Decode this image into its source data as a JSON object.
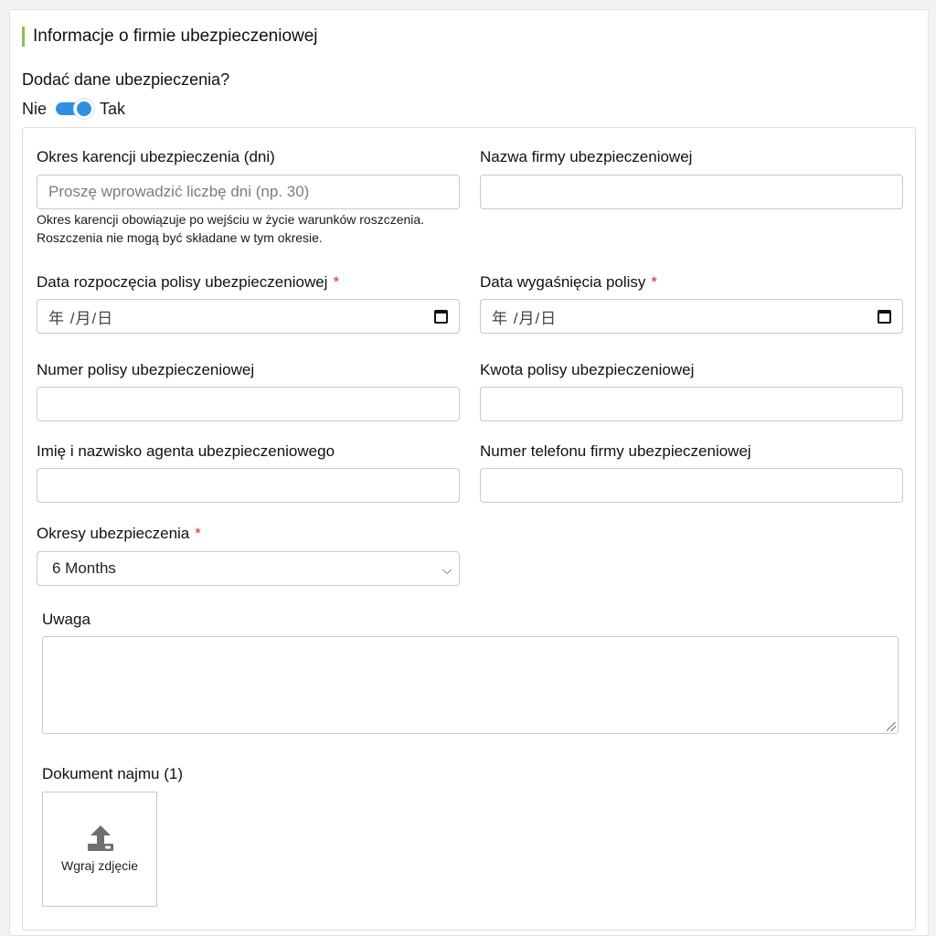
{
  "section": {
    "title": "Informacje o firmie ubezpieczeniowej",
    "question": "Dodać dane ubezpieczenia?",
    "toggle": {
      "off_label": "Nie",
      "on_label": "Tak",
      "state": "on"
    }
  },
  "form": {
    "grace_period": {
      "label": "Okres karencji ubezpieczenia (dni)",
      "placeholder": "Proszę wprowadzić liczbę dni (np. 30)",
      "hint_line1": "Okres karencji obowiązuje po wejściu w życie warunków roszczenia.",
      "hint_line2": "Roszczenia nie mogą być składane w tym okresie."
    },
    "company_name": {
      "label": "Nazwa firmy ubezpieczeniowej",
      "value": ""
    },
    "start_date": {
      "label": "Data rozpoczęcia polisy ubezpieczeniowej",
      "required": "*",
      "placeholder": "年 /月/日"
    },
    "end_date": {
      "label": "Data wygaśnięcia polisy",
      "required": "*",
      "placeholder": "年 /月/日"
    },
    "policy_number": {
      "label": "Numer polisy ubezpieczeniowej",
      "value": ""
    },
    "policy_amount": {
      "label": "Kwota polisy ubezpieczeniowej",
      "value": ""
    },
    "agent_name": {
      "label": "Imię i nazwisko agenta ubezpieczeniowego",
      "value": ""
    },
    "company_phone": {
      "label": "Numer telefonu firmy ubezpieczeniowej",
      "value": ""
    },
    "insurance_periods": {
      "label": "Okresy ubezpieczenia",
      "required": "*",
      "selected": "6 Months"
    },
    "note": {
      "label": "Uwaga",
      "value": ""
    },
    "document": {
      "label": "Dokument najmu (1)",
      "upload_text": "Wgraj zdjęcie"
    }
  },
  "colors": {
    "accent": "#2f8fe0",
    "section_bar": "#8bc34a",
    "required": "#c0392b"
  }
}
